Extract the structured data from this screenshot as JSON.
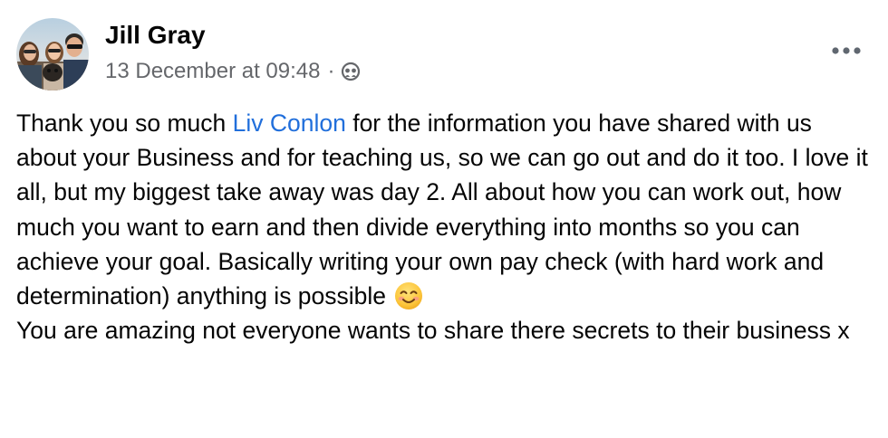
{
  "post": {
    "author": "Jill Gray",
    "timestamp": "13 December at 09:48",
    "separator": "·",
    "audience_icon": "friends-audience-icon",
    "more_icon": "more-horizontal-icon",
    "body": {
      "line1_before": "Thank you so much ",
      "mention": "Liv Conlon",
      "line1_after": " for the information you have shared with us about your Business and for teaching us, so we can go out and do it too. I love it all, but my biggest take away was day 2. All about how you can work out, how much you want to earn and then divide everything into months so you can achieve your goal. Basically writing your own pay check (with hard work and determination) anything is possible ",
      "emoji": "smiling-face-emoji",
      "line2": "You are amazing not everyone wants to share there secrets to their business x"
    },
    "colors": {
      "text": "#050505",
      "secondary": "#65676b",
      "mention": "#216fdb"
    }
  }
}
